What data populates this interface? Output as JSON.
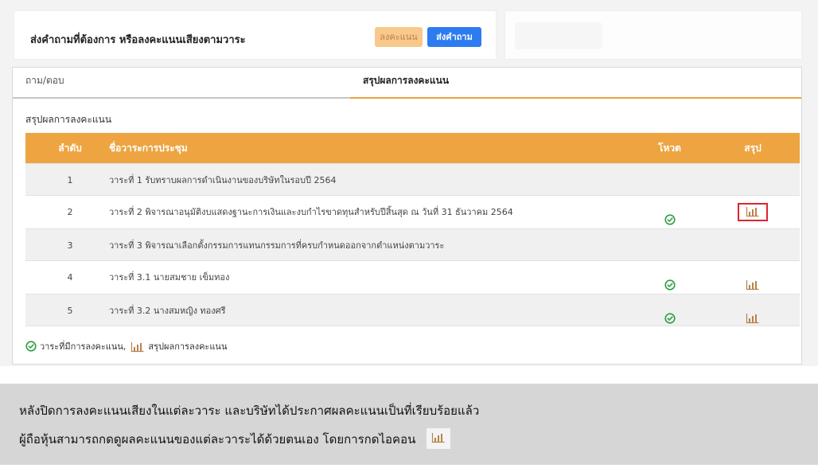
{
  "header": {
    "title": "ส่งคำถามที่ต้องการ หรือลงคะแนนเสียงตามวาระ",
    "vote_button": "ลงคะแนน",
    "ask_button": "ส่งคำถาม"
  },
  "tabs": [
    {
      "label": "ถาม/ตอบ",
      "active": false
    },
    {
      "label": "สรุปผลการลงคะแนน",
      "active": true
    }
  ],
  "section_title": "สรุปผลการลงคะแนน",
  "table": {
    "columns": [
      "ลำดับ",
      "ชื่อวาระการประชุม",
      "โหวต",
      "สรุป"
    ],
    "rows": [
      {
        "no": "1",
        "name": "วาระที่ 1 รับทราบผลการดำเนินงานของบริษัทในรอบปี 2564",
        "voted": false,
        "summary": false
      },
      {
        "no": "2",
        "name": "วาระที่ 2 พิจารณาอนุมัติงบแสดงฐานะการเงินและงบกำไรขาดทุนสำหรับปีสิ้นสุด ณ วันที่ 31 ธันวาคม 2564",
        "voted": true,
        "summary": true,
        "highlighted": true
      },
      {
        "no": "3",
        "name": "วาระที่ 3 พิจารณาเลือกตั้งกรรมการแทนกรรมการที่ครบกำหนดออกจากตำแหน่งตามวาระ",
        "voted": false,
        "summary": false
      },
      {
        "no": "4",
        "name": "วาระที่ 3.1 นายสมชาย เข็มทอง",
        "voted": true,
        "summary": true
      },
      {
        "no": "5",
        "name": "วาระที่ 3.2 นางสมหญิง ทองศรี",
        "voted": true,
        "summary": true
      }
    ]
  },
  "legend": {
    "voted_label": "วาระที่มีการลงคะแนน,",
    "summary_label": "สรุปผลการลงคะแนน"
  },
  "note": {
    "line1": "หลังปิดการลงคะแนนเสียงในแต่ละวาระ และบริษัทได้ประกาศผลคะแนนเป็นที่เรียบร้อยแล้ว",
    "line2": "ผู้ถือหุ้นสามารถกดดูผลคะแนนของแต่ละวาระได้ด้วยตนเอง โดยการกดไอคอน"
  },
  "icons": {
    "check": "check-circle-icon",
    "chart": "bar-chart-icon"
  },
  "colors": {
    "accent": "#eda441",
    "primary": "#2d7bf0",
    "check": "#2e9e3f",
    "chart": "#b9814b",
    "highlight": "#e0242a"
  }
}
